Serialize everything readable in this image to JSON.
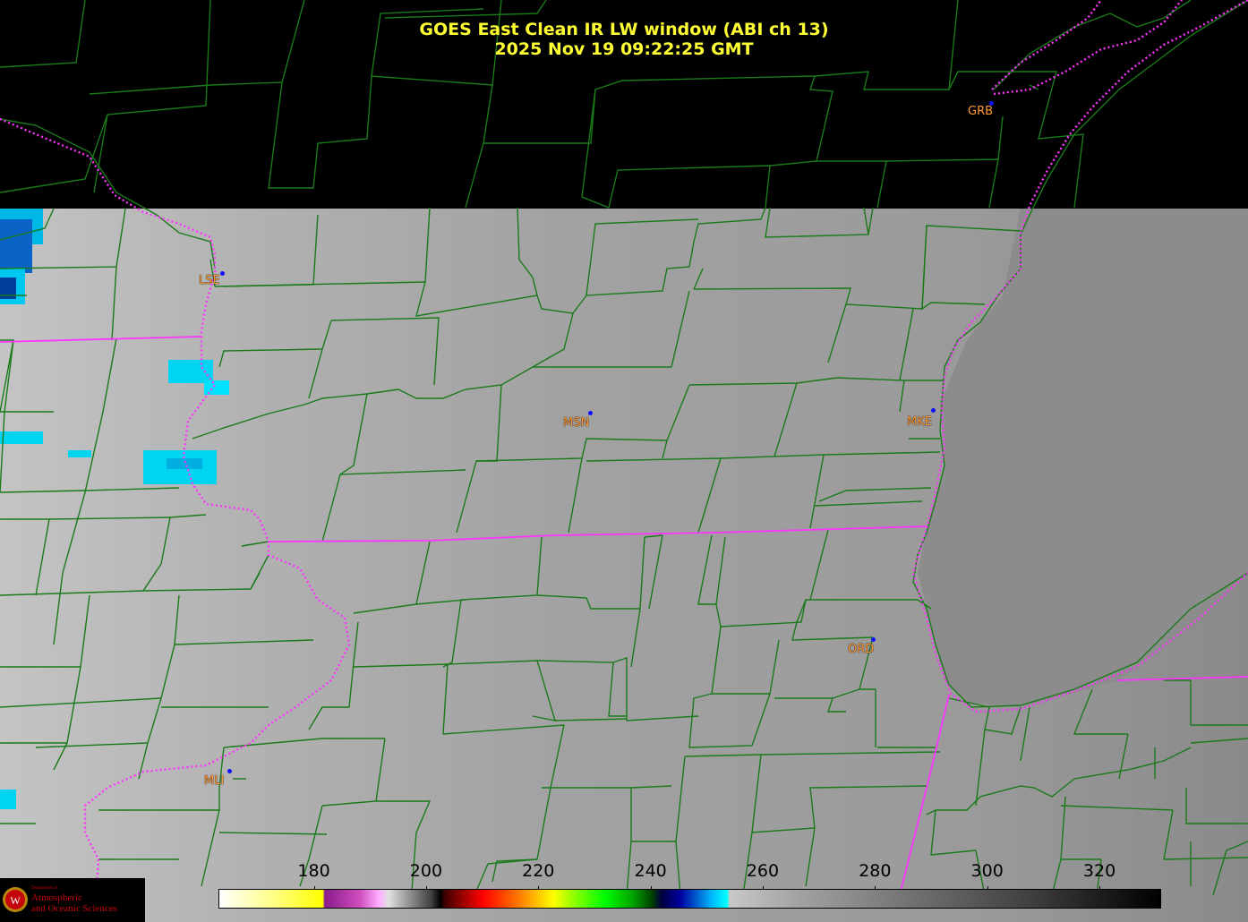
{
  "header": {
    "title_line1": "GOES East Clean IR LW window (ABI ch 13)",
    "title_line2": "2025 Nov 19  09:22:25 GMT"
  },
  "stations": [
    {
      "code": "GRB",
      "style": "plain"
    },
    {
      "code": "LSE",
      "style": "boxed"
    },
    {
      "code": "MSN",
      "style": "boxed"
    },
    {
      "code": "MKE",
      "style": "boxed"
    },
    {
      "code": "ORD",
      "style": "boxed"
    },
    {
      "code": "MLI",
      "style": "boxed"
    }
  ],
  "colorbar": {
    "quantity": "brightness temperature",
    "ticks": [
      "180",
      "200",
      "220",
      "240",
      "260",
      "280",
      "300",
      "320"
    ],
    "range": [
      163,
      331
    ]
  },
  "logo": {
    "dept_line": "Department of",
    "name_line1": "Atmospheric",
    "name_line2": "and Oceanic Sciences"
  },
  "colors": {
    "title": "#ffff33",
    "county_lines": "#1a7a1a",
    "state_lines": "#ff33ff",
    "station_label": "#ff9933",
    "station_dot": "#1010ff",
    "background_no_data": "#000000"
  }
}
